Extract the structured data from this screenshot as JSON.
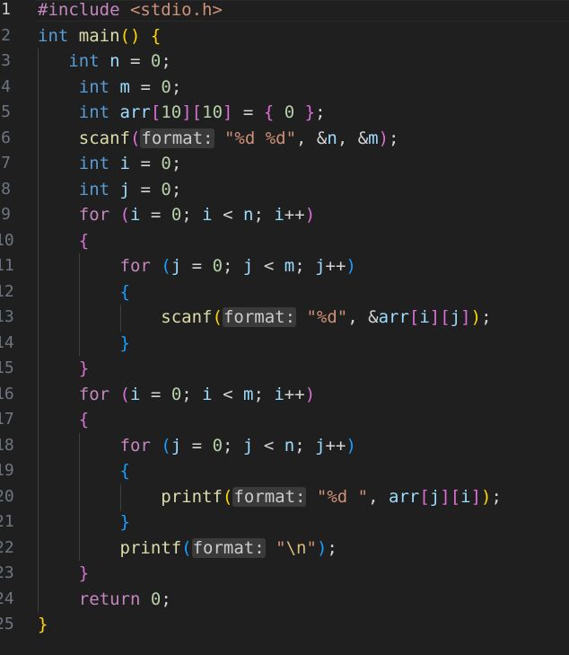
{
  "editor": {
    "language": "c",
    "active_line": 1,
    "line_numbers": [
      "1",
      "2",
      "3",
      "4",
      "5",
      "6",
      "7",
      "8",
      "9",
      "10",
      "11",
      "12",
      "13",
      "14",
      "15",
      "16",
      "17",
      "18",
      "19",
      "20",
      "21",
      "22",
      "23",
      "24",
      "25"
    ],
    "tokens": {
      "l1": {
        "directive": "#include",
        "header": "<stdio.h>"
      },
      "l2": {
        "type": "int",
        "name": "main",
        "open": "()",
        "brace": "{"
      },
      "l3": {
        "type": "int",
        "name": "n",
        "eq": "=",
        "val": "0",
        "semi": ";"
      },
      "l4": {
        "type": "int",
        "name": "m",
        "eq": "=",
        "val": "0",
        "semi": ";"
      },
      "l5": {
        "type": "int",
        "name": "arr",
        "b1o": "[",
        "d1": "10",
        "b1c": "]",
        "b2o": "[",
        "d2": "10",
        "b2c": "]",
        "eq": "=",
        "bo": "{",
        "val": "0",
        "bc": "}",
        "semi": ";"
      },
      "l6": {
        "fn": "scanf",
        "po": "(",
        "hint": "format:",
        "str": "\"%d %d\"",
        "rest1": ", &",
        "a1": "n",
        "rest2": ", &",
        "a2": "m",
        "pc": ")",
        "semi": ";"
      },
      "l7": {
        "type": "int",
        "name": "i",
        "eq": "=",
        "val": "0",
        "semi": ";"
      },
      "l8": {
        "type": "int",
        "name": "j",
        "eq": "=",
        "val": "0",
        "semi": ";"
      },
      "l9": {
        "kw": "for",
        "po": "(",
        "v1": "i",
        "eq": "=",
        "val": "0",
        "s1": ";",
        "v2": "i",
        "lt": "<",
        "v3": "n",
        "s2": ";",
        "v4": "i",
        "inc": "++",
        "pc": ")"
      },
      "l10": {
        "brace": "{"
      },
      "l11": {
        "kw": "for",
        "po": "(",
        "v1": "j",
        "eq": "=",
        "val": "0",
        "s1": ";",
        "v2": "j",
        "lt": "<",
        "v3": "m",
        "s2": ";",
        "v4": "j",
        "inc": "++",
        "pc": ")"
      },
      "l12": {
        "brace": "{"
      },
      "l13": {
        "fn": "scanf",
        "po": "(",
        "hint": "format:",
        "str": "\"%d\"",
        "comma": ", &",
        "arr": "arr",
        "i1o": "[",
        "iv": "i",
        "i1c": "]",
        "i2o": "[",
        "jv": "j",
        "i2c": "]",
        "pc": ")",
        "semi": ";"
      },
      "l14": {
        "brace": "}"
      },
      "l15": {
        "brace": "}"
      },
      "l16": {
        "kw": "for",
        "po": "(",
        "v1": "i",
        "eq": "=",
        "val": "0",
        "s1": ";",
        "v2": "i",
        "lt": "<",
        "v3": "m",
        "s2": ";",
        "v4": "i",
        "inc": "++",
        "pc": ")"
      },
      "l17": {
        "brace": "{"
      },
      "l18": {
        "kw": "for",
        "po": "(",
        "v1": "j",
        "eq": "=",
        "val": "0",
        "s1": ";",
        "v2": "j",
        "lt": "<",
        "v3": "n",
        "s2": ";",
        "v4": "j",
        "inc": "++",
        "pc": ")"
      },
      "l19": {
        "brace": "{"
      },
      "l20": {
        "fn": "printf",
        "po": "(",
        "hint": "format:",
        "str": "\"%d \"",
        "comma": ", ",
        "arr": "arr",
        "i1o": "[",
        "jv": "j",
        "i1c": "]",
        "i2o": "[",
        "iv": "i",
        "i2c": "]",
        "pc": ")",
        "semi": ";"
      },
      "l21": {
        "brace": "}"
      },
      "l22": {
        "fn": "printf",
        "po": "(",
        "hint": "format:",
        "q1": "\"",
        "esc": "\\n",
        "q2": "\"",
        "pc": ")",
        "semi": ";"
      },
      "l23": {
        "brace": "}"
      },
      "l24": {
        "kw": "return",
        "val": "0",
        "semi": ";"
      },
      "l25": {
        "brace": "}"
      }
    }
  }
}
